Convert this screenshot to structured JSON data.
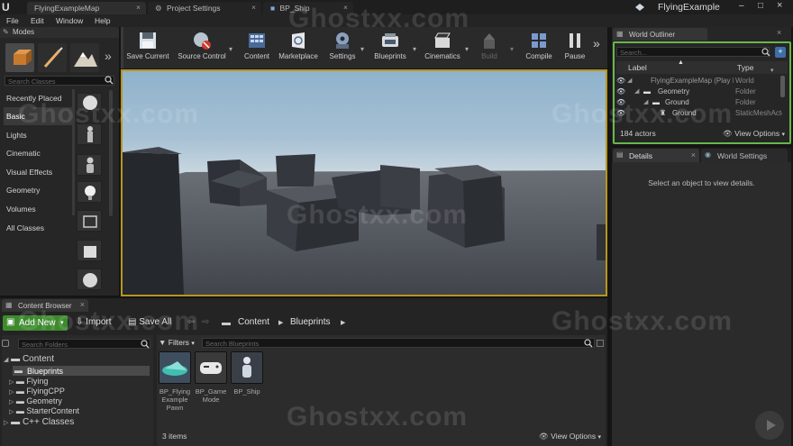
{
  "window": {
    "logo": "U",
    "tabs": [
      {
        "label": "FlyingExampleMap",
        "close": "×"
      },
      {
        "label": "Project Settings",
        "close": "×"
      },
      {
        "label": "BP_Ship",
        "close": "×"
      }
    ],
    "project_name": "FlyingExample",
    "controls": {
      "minimize": "–",
      "maximize": "□",
      "close": "×"
    }
  },
  "menu": [
    "File",
    "Edit",
    "Window",
    "Help"
  ],
  "modes": {
    "title": "Modes",
    "search_placeholder": "Search Classes",
    "categories": [
      "Recently Placed",
      "Basic",
      "Lights",
      "Cinematic",
      "Visual Effects",
      "Geometry",
      "Volumes",
      "All Classes"
    ],
    "selected": "Basic"
  },
  "toolbar": {
    "buttons": [
      {
        "label": "Save Current",
        "icon": "save-icon"
      },
      {
        "label": "Source Control",
        "icon": "source-control-icon"
      },
      {
        "label": "Content",
        "icon": "content-icon"
      },
      {
        "label": "Marketplace",
        "icon": "marketplace-icon"
      },
      {
        "label": "Settings",
        "icon": "settings-icon"
      },
      {
        "label": "Blueprints",
        "icon": "blueprints-icon"
      },
      {
        "label": "Cinematics",
        "icon": "cinematics-icon"
      },
      {
        "label": "Build",
        "icon": "build-icon"
      },
      {
        "label": "Compile",
        "icon": "compile-icon"
      },
      {
        "label": "Pause",
        "icon": "pause-icon"
      }
    ],
    "more": "»"
  },
  "outliner": {
    "title": "World Outliner",
    "search_placeholder": "Search...",
    "col_label": "Label",
    "col_type": "Type",
    "rows": [
      {
        "label": "FlyingExampleMap (Play In Editor)",
        "type": "World"
      },
      {
        "label": "Geometry",
        "type": "Folder"
      },
      {
        "label": "Ground",
        "type": "Folder"
      },
      {
        "label": "Ground",
        "type": "StaticMeshActor"
      }
    ],
    "actor_count": "184 actors",
    "view_options": "View Options"
  },
  "details": {
    "tab_details": "Details",
    "tab_world_settings": "World Settings",
    "empty_text": "Select an object to view details."
  },
  "content_browser": {
    "title": "Content Browser",
    "add_new": "Add New",
    "import": "Import",
    "save_all": "Save All",
    "path": [
      "Content",
      "Blueprints"
    ],
    "folder_search_placeholder": "Search Folders",
    "filters": "Filters",
    "asset_search_placeholder": "Search Blueprints",
    "folders": [
      {
        "label": "Content",
        "level": 0
      },
      {
        "label": "Blueprints",
        "level": 1
      },
      {
        "label": "Flying",
        "level": 1
      },
      {
        "label": "FlyingCPP",
        "level": 1
      },
      {
        "label": "Geometry",
        "level": 1
      },
      {
        "label": "StarterContent",
        "level": 1
      },
      {
        "label": "C++ Classes",
        "level": 0
      }
    ],
    "selected_folder": "Blueprints",
    "assets": [
      {
        "label": "BP_Flying Example Pawn",
        "icon": "ship-thumbnail"
      },
      {
        "label": "BP_Game Mode",
        "icon": "gamepad-thumbnail"
      },
      {
        "label": "BP_Ship",
        "icon": "pawn-thumbnail"
      }
    ],
    "item_count": "3 items",
    "view_options": "View Options"
  },
  "watermark": "Ghostxx.com",
  "colors": {
    "viewport_border": "#b8961f",
    "outliner_border": "#66b84a",
    "add_new": "#3d8a2e"
  }
}
